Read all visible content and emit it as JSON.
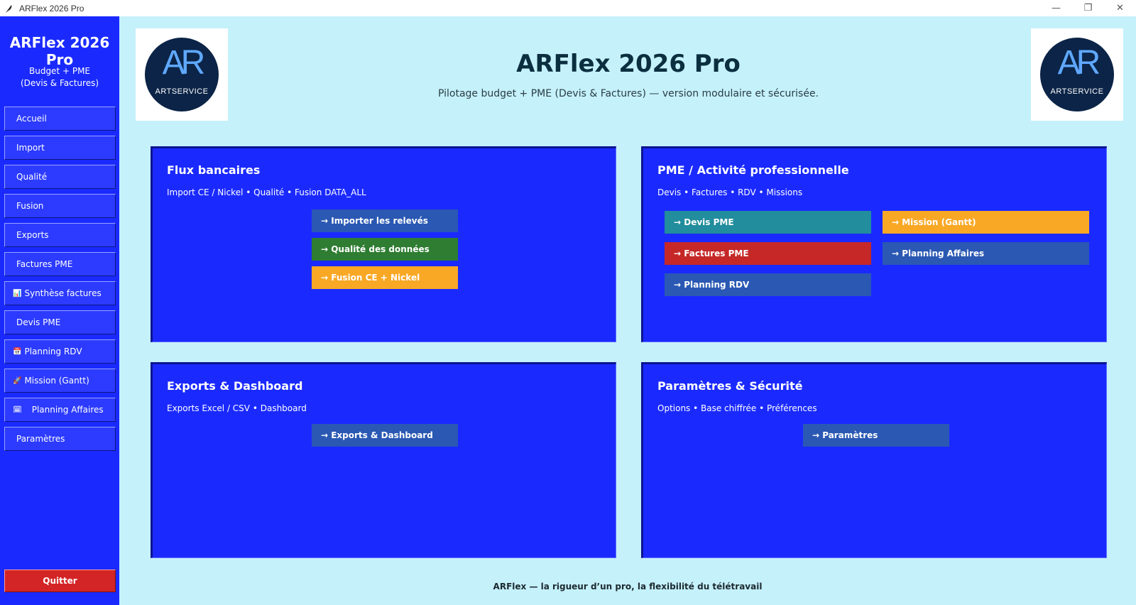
{
  "window": {
    "title": "ARFlex 2026 Pro",
    "controls": [
      "—",
      "❐",
      "✕"
    ]
  },
  "sidebar": {
    "title": "ARFlex 2026 Pro",
    "subtitle_line1": "Budget + PME",
    "subtitle_line2": "(Devis & Factures)",
    "items": [
      {
        "label": "Accueil",
        "icon": ""
      },
      {
        "label": "Import",
        "icon": ""
      },
      {
        "label": "Qualité",
        "icon": ""
      },
      {
        "label": "Fusion",
        "icon": ""
      },
      {
        "label": "Exports",
        "icon": ""
      },
      {
        "label": "Factures PME",
        "icon": ""
      },
      {
        "label": "Synthèse factures",
        "icon": "📊"
      },
      {
        "label": "Devis PME",
        "icon": ""
      },
      {
        "label": "Planning RDV",
        "icon": "📅"
      },
      {
        "label": "Mission (Gantt)",
        "icon": "🚀"
      },
      {
        "label": "Planning Affaires",
        "icon": "🗓"
      },
      {
        "label": "Paramètres",
        "icon": ""
      }
    ],
    "quit_label": "Quitter"
  },
  "logo": {
    "letters": "AR",
    "text": "ARTSERVICE"
  },
  "header": {
    "title": "ARFlex 2026 Pro",
    "subtitle": "Pilotage budget + PME (Devis & Factures) — version modulaire et sécurisée."
  },
  "panels": {
    "flux": {
      "title": "Flux bancaires",
      "subtitle": "Import CE / Nickel • Qualité • Fusion DATA_ALL",
      "buttons": [
        "→ Importer les relevés",
        "→ Qualité des données",
        "→ Fusion CE + Nickel"
      ]
    },
    "pme": {
      "title": "PME / Activité professionnelle",
      "subtitle": "Devis • Factures • RDV • Missions",
      "buttons": [
        "→ Devis PME",
        "→ Mission (Gantt)",
        "→ Factures PME",
        "→ Planning Affaires",
        "→ Planning RDV"
      ]
    },
    "exports": {
      "title": "Exports & Dashboard",
      "subtitle": "Exports Excel / CSV • Dashboard",
      "buttons": [
        "→ Exports & Dashboard"
      ]
    },
    "params": {
      "title": "Paramètres & Sécurité",
      "subtitle": "Options • Base chiffrée • Préférences",
      "buttons": [
        "→ Paramètres"
      ]
    }
  },
  "colors": {
    "background": "#c5f1fb",
    "panel": "#1a2aff",
    "btn_blue": "#2a58b3",
    "btn_green": "#2e7d32",
    "btn_orange": "#f9a825",
    "btn_teal": "#218d9d",
    "btn_red": "#c62828",
    "quit": "#d32525"
  },
  "footer": {
    "text": "ARFlex — la rigueur d’un pro, la flexibilité du télétravail"
  }
}
